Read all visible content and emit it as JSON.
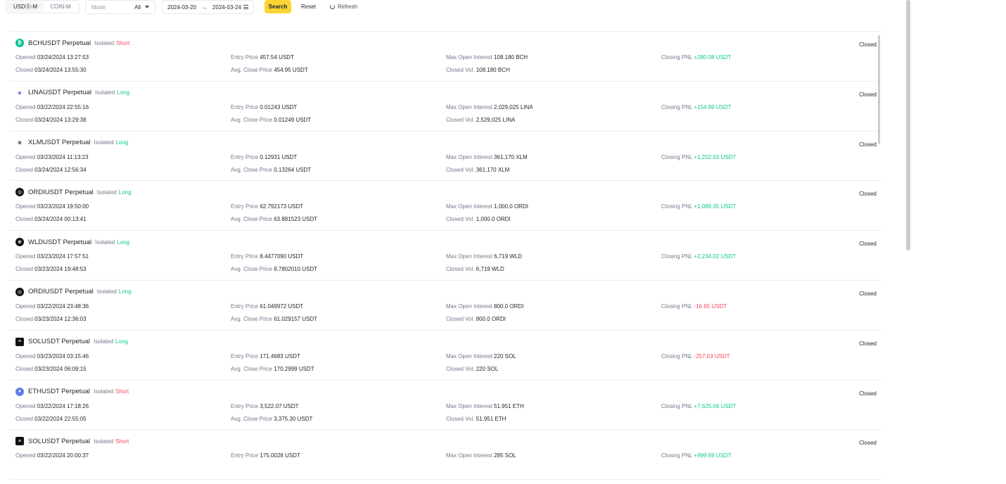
{
  "toolbar": {
    "tabs": [
      {
        "label": "USDⓈ-M",
        "active": true
      },
      {
        "label": "COIN-M",
        "active": false
      }
    ],
    "mode": {
      "placeholder": "Mode",
      "value": "All"
    },
    "date_range": {
      "start": "2024-03-20",
      "end": "2024-03-24"
    },
    "search_label": "Search",
    "reset_label": "Reset",
    "refresh_label": "Refresh"
  },
  "labels": {
    "opened": "Opened",
    "closed": "Closed",
    "entry_price": "Entry Price",
    "avg_close_price": "Avg. Close Price",
    "max_open_interest": "Max Open Interest",
    "closed_vol": "Closed Vol.",
    "closing_pnl": "Closing PNL",
    "isolated": "Isolated"
  },
  "colors": {
    "accent": "#fcd535",
    "long": "#0ecb81",
    "short": "#f6465d"
  },
  "positions": [
    {
      "symbol": "BCHUSDT Perpetual",
      "icon": "bch-icon",
      "icon_color": "#0ac18e",
      "icon_char": "₿",
      "side": "Short",
      "side_class": "short",
      "status": "Closed",
      "opened": "03/24/2024 13:27:53",
      "closed": "03/24/2024 13:55:30",
      "entry_price": "457.54 USDT",
      "avg_close_price": "454.95 USDT",
      "max_open_interest": "108.180 BCH",
      "closed_vol": "108.180 BCH",
      "pnl": "+280.08 USDT",
      "pnl_class": "pos"
    },
    {
      "symbol": "LINAUSDT Perpetual",
      "icon": "lina-icon",
      "icon_color": "#6d7cf2",
      "icon_char": "◆",
      "side": "Long",
      "side_class": "long",
      "status": "Closed",
      "opened": "03/22/2024 22:55:16",
      "closed": "03/24/2024 13:29:38",
      "entry_price": "0.01243 USDT",
      "avg_close_price": "0.01249 USDT",
      "max_open_interest": "2,029,025 LINA",
      "closed_vol": "2,529,025 LINA",
      "pnl": "+154.99 USDT",
      "pnl_class": "pos"
    },
    {
      "symbol": "XLMUSDT Perpetual",
      "icon": "xlm-icon",
      "icon_color": "#ffffff",
      "icon_char": "≋",
      "side": "Long",
      "side_class": "long",
      "status": "Closed",
      "opened": "03/23/2024 11:13:23",
      "closed": "03/24/2024 12:56:34",
      "entry_price": "0.12931 USDT",
      "avg_close_price": "0.13264 USDT",
      "max_open_interest": "361,170 XLM",
      "closed_vol": "361,170 XLM",
      "pnl": "+1,202.63 USDT",
      "pnl_class": "pos"
    },
    {
      "symbol": "ORDIUSDT Perpetual",
      "icon": "ordi-icon",
      "icon_color": "#111111",
      "icon_char": "◎",
      "side": "Long",
      "side_class": "long",
      "status": "Closed",
      "opened": "03/23/2024 19:50:00",
      "closed": "03/24/2024 00:13:41",
      "entry_price": "62.792173 USDT",
      "avg_close_price": "63.881523 USDT",
      "max_open_interest": "1,000.0 ORDI",
      "closed_vol": "1,000.0 ORDI",
      "pnl": "+1,089.35 USDT",
      "pnl_class": "pos"
    },
    {
      "symbol": "WLDUSDT Perpetual",
      "icon": "wld-icon",
      "icon_color": "#111111",
      "icon_char": "⊛",
      "side": "Long",
      "side_class": "long",
      "status": "Closed",
      "opened": "03/23/2024 17:57:51",
      "closed": "03/23/2024 19:48:53",
      "entry_price": "8.4477090 USDT",
      "avg_close_price": "8.7802010 USDT",
      "max_open_interest": "6,719 WLD",
      "closed_vol": "6,719 WLD",
      "pnl": "+2,234.02 USDT",
      "pnl_class": "pos"
    },
    {
      "symbol": "ORDIUSDT Perpetual",
      "icon": "ordi-icon",
      "icon_color": "#111111",
      "icon_char": "◎",
      "side": "Long",
      "side_class": "long",
      "status": "Closed",
      "opened": "03/22/2024 23:48:36",
      "closed": "03/23/2024 12:36:03",
      "entry_price": "61.049972 USDT",
      "avg_close_price": "61.029157 USDT",
      "max_open_interest": "800.0 ORDI",
      "closed_vol": "800.0 ORDI",
      "pnl": "-16.65 USDT",
      "pnl_class": "neg"
    },
    {
      "symbol": "SOLUSDT Perpetual",
      "icon": "sol-icon",
      "icon_color": "#111111",
      "icon_char": "≡",
      "side": "Long",
      "side_class": "long",
      "status": "Closed",
      "opened": "03/23/2024 03:15:46",
      "closed": "03/23/2024 06:09:15",
      "entry_price": "171.4683 USDT",
      "avg_close_price": "170.2999 USDT",
      "max_open_interest": "220 SOL",
      "closed_vol": "220 SOL",
      "pnl": "-257.03 USDT",
      "pnl_class": "neg"
    },
    {
      "symbol": "ETHUSDT Perpetual",
      "icon": "eth-icon",
      "icon_color": "#627eea",
      "icon_char": "♦",
      "side": "Short",
      "side_class": "short",
      "status": "Closed",
      "opened": "03/22/2024 17:18:26",
      "closed": "03/22/2024 22:55:05",
      "entry_price": "3,522.07 USDT",
      "avg_close_price": "3,375.30 USDT",
      "max_open_interest": "51.951 ETH",
      "closed_vol": "51.951 ETH",
      "pnl": "+7,625.04 USDT",
      "pnl_class": "pos"
    },
    {
      "symbol": "SOLUSDT Perpetual",
      "icon": "sol-icon",
      "icon_color": "#111111",
      "icon_char": "≡",
      "side": "Short",
      "side_class": "short",
      "status": "Closed",
      "opened": "03/22/2024 20:00:37",
      "closed": "",
      "entry_price": "175.0028 USDT",
      "avg_close_price": "",
      "max_open_interest": "285 SOL",
      "closed_vol": "",
      "pnl": "+999.69 USDT",
      "pnl_class": "pos"
    }
  ]
}
